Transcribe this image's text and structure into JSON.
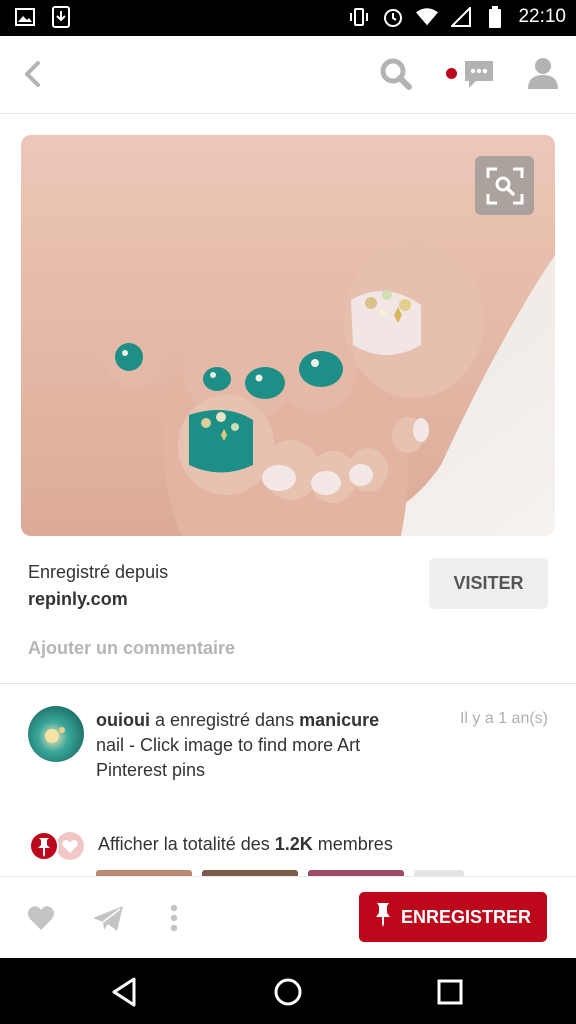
{
  "status_bar": {
    "time": "22:10",
    "left_icons": [
      "gallery-icon",
      "download-icon"
    ],
    "right_icons": [
      "vibrate-icon",
      "alarm-icon",
      "wifi-icon",
      "signal-icon",
      "battery-icon"
    ]
  },
  "topbar": {
    "icons": [
      "back-arrow-icon",
      "search-icon",
      "notification-dot",
      "chat-icon",
      "profile-icon"
    ]
  },
  "pin": {
    "image_icon": "visual-search-icon"
  },
  "source": {
    "saved_from_label": "Enregistré depuis",
    "domain": "repinly.com",
    "visit_label": "VISITER"
  },
  "comment": {
    "placeholder": "Ajouter un commentaire"
  },
  "activity": {
    "user": "ouioui",
    "action": " a enregistré dans ",
    "board": "manicure",
    "description": "nail - Click image to find more Art Pinterest pins",
    "time": "Il y a 1 an(s)"
  },
  "members": {
    "prefix": "Afficher la totalité des ",
    "count": "1.2K",
    "suffix": " membres"
  },
  "actions": {
    "icons": [
      "heart-icon",
      "send-icon",
      "more-icon"
    ],
    "save_label": "ENREGISTRER"
  },
  "colors": {
    "brand_red": "#bd081c",
    "teal_polish": "#1e8f86"
  },
  "navbar": {
    "icons": [
      "back-triangle-icon",
      "home-circle-icon",
      "recents-square-icon"
    ]
  }
}
